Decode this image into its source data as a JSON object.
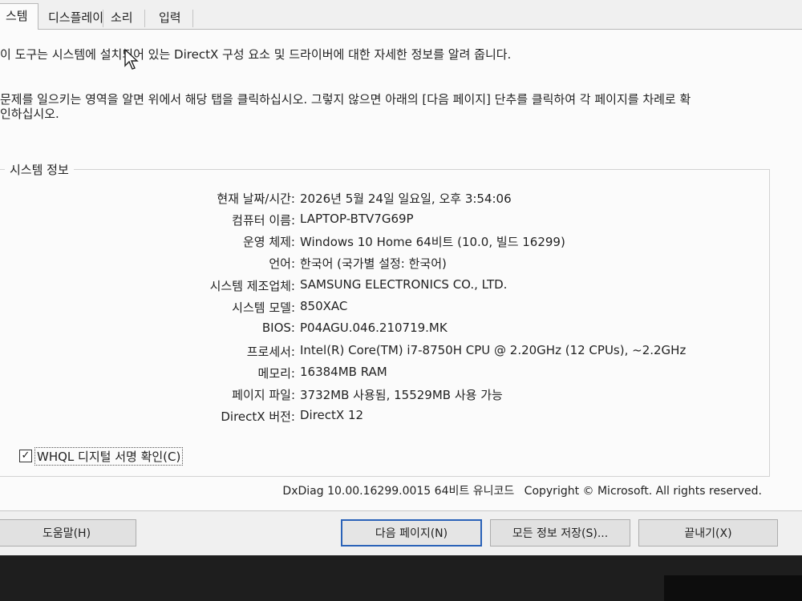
{
  "tabs": [
    {
      "label": "스템",
      "active": true
    },
    {
      "label": "디스플레이",
      "active": false
    },
    {
      "label": "소리",
      "active": false
    },
    {
      "label": "입력",
      "active": false
    }
  ],
  "intro": {
    "line1": "이 도구는 시스템에 설치되어 있는 DirectX 구성 요소 및 드라이버에 대한 자세한 정보를 알려 줍니다.",
    "line2": "문제를 일으키는 영역을 알면 위에서 해당 탭을 클릭하십시오. 그렇지 않으면 아래의 [다음 페이지] 단추를 클릭하여 각 페이지를 차례로 확",
    "line3": "인하십시오."
  },
  "system_info": {
    "title": "시스템 정보",
    "rows": [
      {
        "label": "현재 날짜/시간:",
        "value": "2026년 5월 24일 일요일, 오후 3:54:06"
      },
      {
        "label": "컴퓨터 이름:",
        "value": "LAPTOP-BTV7G69P"
      },
      {
        "label": "운영 체제:",
        "value": "Windows 10 Home 64비트 (10.0, 빌드 16299)"
      },
      {
        "label": "언어:",
        "value": "한국어 (국가별 설정: 한국어)"
      },
      {
        "label": "시스템 제조업체:",
        "value": "SAMSUNG ELECTRONICS CO., LTD."
      },
      {
        "label": "시스템 모델:",
        "value": "850XAC"
      },
      {
        "label": "BIOS:",
        "value": "P04AGU.046.210719.MK"
      },
      {
        "label": "프로세서:",
        "value": "Intel(R) Core(TM) i7-8750H CPU @ 2.20GHz (12 CPUs), ~2.2GHz"
      },
      {
        "label": "메모리:",
        "value": "16384MB RAM"
      },
      {
        "label": "페이지 파일:",
        "value": "3732MB 사용됨, 15529MB 사용 가능"
      },
      {
        "label": "DirectX 버전:",
        "value": "DirectX 12"
      }
    ]
  },
  "whql": {
    "label": "WHQL 디지털 서명 확인(C)",
    "checked": true,
    "mark": "✓"
  },
  "footer": {
    "version": "DxDiag 10.00.16299.0015 64비트 유니코드",
    "copyright": "Copyright © Microsoft. All rights reserved."
  },
  "buttons": {
    "help": "도움말(H)",
    "next_page": "다음 페이지(N)",
    "save_all": "모든 정보 저장(S)...",
    "exit": "끝내기(X)"
  },
  "colors": {
    "panel_bg": "#fbfbfb",
    "window_bg": "#f0f0f0",
    "default_button_border": "#2a62b8"
  }
}
